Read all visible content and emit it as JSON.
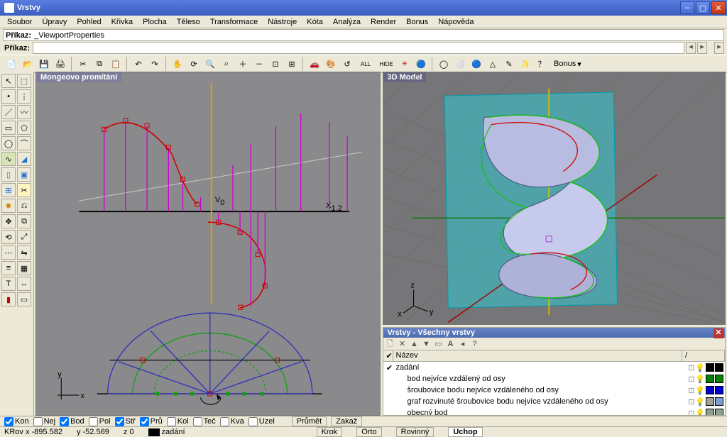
{
  "titlebar": {
    "title": "Vrstvy"
  },
  "menu": [
    "Soubor",
    "Úpravy",
    "Pohled",
    "Křivka",
    "Plocha",
    "Těleso",
    "Transformace",
    "Nástroje",
    "Kóta",
    "Analýza",
    "Render",
    "Bonus",
    "Nápověda"
  ],
  "cmd": {
    "label1": "Příkaz:",
    "line1": "_ViewportProperties",
    "label2": "Příkaz:"
  },
  "toolbar_top": {
    "bonus": "Bonus"
  },
  "viewport": {
    "left_title": "Mongeovo promítání",
    "right_title": "3D Model",
    "axes_left": {
      "x": "x",
      "y": "y"
    },
    "axes_right": {
      "x": "x",
      "y": "y",
      "z": "z"
    },
    "label_v0": "V",
    "label_v0_sub": "0",
    "label_x12": "X",
    "label_x12_sub": "1,2"
  },
  "layers": {
    "panel_title": "Vrstvy - Všechny vrstvy",
    "header": {
      "name": "Název",
      "divider": "/"
    },
    "rows": [
      {
        "name": "zadání",
        "checked": true,
        "indent": 0,
        "colors": [
          "#000000",
          "#000000"
        ]
      },
      {
        "name": "bod nejvíce vzdálený od osy",
        "checked": false,
        "indent": 1,
        "colors": [
          "#088008",
          "#088008"
        ]
      },
      {
        "name": "šroubovice bodu nejvíce vzdáleného od osy",
        "checked": false,
        "indent": 1,
        "colors": [
          "#0000d0",
          "#0000d0"
        ]
      },
      {
        "name": "graf rozvinuté šroubovice bodu nejvíce vzdáleného od osy",
        "checked": false,
        "indent": 1,
        "colors": [
          "#a0a0a0",
          "#7aa0d0"
        ]
      },
      {
        "name": "obecný bod",
        "checked": false,
        "indent": 1,
        "colors": [
          "#8aa090",
          "#8aa090"
        ]
      }
    ]
  },
  "osnap": {
    "items": [
      {
        "label": "Kon",
        "checked": true
      },
      {
        "label": "Nej",
        "checked": false
      },
      {
        "label": "Bod",
        "checked": true
      },
      {
        "label": "Pol",
        "checked": false
      },
      {
        "label": "Stř",
        "checked": true
      },
      {
        "label": "Prů",
        "checked": true
      },
      {
        "label": "Kol",
        "checked": false
      },
      {
        "label": "Teč",
        "checked": false
      },
      {
        "label": "Kva",
        "checked": false
      },
      {
        "label": "Uzel",
        "checked": false
      }
    ],
    "toggles": [
      "Průmět",
      "Zakaž"
    ]
  },
  "status": {
    "coord": "KRov x -895.582",
    "y": "y -52.569",
    "z": "z 0",
    "layer": "zadání",
    "buttons": [
      "Krok",
      "Orto",
      "Rovinný",
      "Uchop"
    ]
  }
}
